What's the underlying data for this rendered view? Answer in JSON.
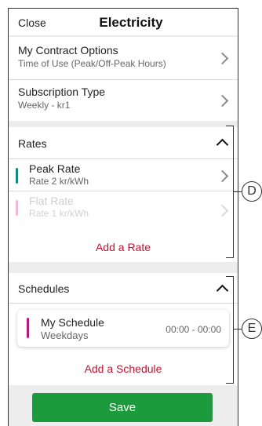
{
  "header": {
    "close_label": "Close",
    "title": "Electricity"
  },
  "contract": {
    "label": "My Contract Options",
    "value": "Time of Use (Peak/Off-Peak Hours)"
  },
  "subscription": {
    "label": "Subscription Type",
    "value": "Weekly - kr1"
  },
  "rates": {
    "heading": "Rates",
    "items": [
      {
        "name": "Peak Rate",
        "detail": "Rate 2 kr/kWh",
        "accent": "#0f8a7e"
      },
      {
        "name": "Flat Rate",
        "detail": "Rate 1 kr/kWh",
        "accent": "#f2b8d6"
      }
    ],
    "add_label": "Add a Rate"
  },
  "schedules": {
    "heading": "Schedules",
    "items": [
      {
        "name": "My Schedule",
        "days": "Weekdays",
        "time": "00:00 - 00:00",
        "accent": "#c0157a"
      }
    ],
    "add_label": "Add  a Schedule"
  },
  "save_label": "Save",
  "callouts": {
    "rates": "D",
    "schedules": "E"
  },
  "colors": {
    "accent_red": "#c8102e",
    "save_green": "#1d9a3b"
  }
}
